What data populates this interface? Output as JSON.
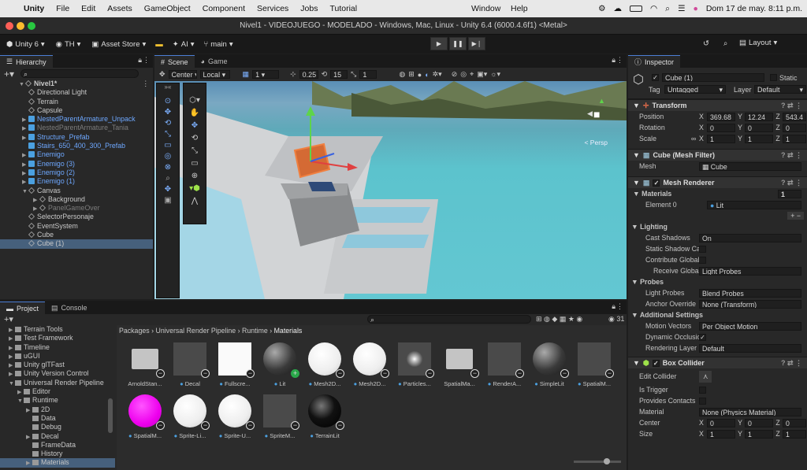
{
  "mac_menu": {
    "app": "Unity",
    "items": [
      "File",
      "Edit",
      "Assets",
      "GameObject",
      "Component",
      "Services",
      "Jobs",
      "Tutorial"
    ],
    "window": "Window",
    "help": "Help",
    "datetime": "Dom 17 de may. 8:11 p.m."
  },
  "title": "Nivel1 - VIDEOJUEGO - MODELADO - Windows, Mac, Linux - Unity 6.4 (6000.4.6f1) <Metal>",
  "toolbar": {
    "unity": "Unity 6",
    "account": "TH",
    "asset_store": "Asset Store",
    "ai": "AI",
    "branch": "main",
    "layout": "Layout"
  },
  "hierarchy": {
    "tab": "Hierarchy",
    "scene": "Nivel1*",
    "items": [
      {
        "label": "Directional Light",
        "indent": 2,
        "type": "obj",
        "arrow": ""
      },
      {
        "label": "Terrain",
        "indent": 2,
        "type": "obj",
        "arrow": ""
      },
      {
        "label": "Capsule",
        "indent": 2,
        "type": "obj",
        "arrow": ""
      },
      {
        "label": "NestedParentArmature_Unpack",
        "indent": 2,
        "type": "prefab",
        "arrow": "▶",
        "hl": true
      },
      {
        "label": "NestedParentArmature_Tania",
        "indent": 2,
        "type": "prefab",
        "arrow": "▶",
        "dim": true
      },
      {
        "label": "Structure_Prefab",
        "indent": 2,
        "type": "prefab",
        "arrow": "▶",
        "hl": true
      },
      {
        "label": "Stairs_650_400_300_Prefab",
        "indent": 2,
        "type": "prefab",
        "arrow": "",
        "hl": true
      },
      {
        "label": "Enemigo",
        "indent": 2,
        "type": "prefab",
        "arrow": "▶",
        "hl": true
      },
      {
        "label": "Enemigo (3)",
        "indent": 2,
        "type": "prefab",
        "arrow": "▶",
        "hl": true
      },
      {
        "label": "Enemigo (2)",
        "indent": 2,
        "type": "prefab",
        "arrow": "▶",
        "hl": true
      },
      {
        "label": "Enemigo (1)",
        "indent": 2,
        "type": "prefab",
        "arrow": "▶",
        "hl": true
      },
      {
        "label": "Canvas",
        "indent": 2,
        "type": "obj",
        "arrow": "▼"
      },
      {
        "label": "Background",
        "indent": 3,
        "type": "obj",
        "arrow": "▶"
      },
      {
        "label": "PanelGameOver",
        "indent": 3,
        "type": "obj",
        "arrow": "▶",
        "dim": true
      },
      {
        "label": "SelectorPersonaje",
        "indent": 2,
        "type": "obj",
        "arrow": ""
      },
      {
        "label": "EventSystem",
        "indent": 2,
        "type": "obj",
        "arrow": ""
      },
      {
        "label": "Cube",
        "indent": 2,
        "type": "obj",
        "arrow": ""
      },
      {
        "label": "Cube (1)",
        "indent": 2,
        "type": "obj",
        "arrow": "",
        "sel": true
      }
    ]
  },
  "scene": {
    "tab_scene": "Scene",
    "tab_game": "Game",
    "pivot": "Center",
    "space": "Local",
    "grid": "1",
    "snap1": "0.25",
    "snap2": "15",
    "snap3": "1",
    "persp": "< Persp"
  },
  "project": {
    "tab": "Project",
    "console": "Console",
    "count": "31",
    "breadcrumb": [
      "Packages",
      "Universal Render Pipeline",
      "Runtime",
      "Materials"
    ],
    "tree": [
      {
        "label": "Terrain Tools",
        "indent": 1,
        "arrow": "▶"
      },
      {
        "label": "Test Framework",
        "indent": 1,
        "arrow": "▶"
      },
      {
        "label": "Timeline",
        "indent": 1,
        "arrow": "▶"
      },
      {
        "label": "uGUI",
        "indent": 1,
        "arrow": "▶"
      },
      {
        "label": "Unity glTFast",
        "indent": 1,
        "arrow": "▶"
      },
      {
        "label": "Unity Version Control",
        "indent": 1,
        "arrow": "▶"
      },
      {
        "label": "Universal Render Pipeline",
        "indent": 1,
        "arrow": "▼"
      },
      {
        "label": "Editor",
        "indent": 2,
        "arrow": "▶"
      },
      {
        "label": "Runtime",
        "indent": 2,
        "arrow": "▼"
      },
      {
        "label": "2D",
        "indent": 3,
        "arrow": "▶"
      },
      {
        "label": "Data",
        "indent": 3,
        "arrow": ""
      },
      {
        "label": "Debug",
        "indent": 3,
        "arrow": ""
      },
      {
        "label": "Decal",
        "indent": 3,
        "arrow": "▶"
      },
      {
        "label": "FrameData",
        "indent": 3,
        "arrow": ""
      },
      {
        "label": "History",
        "indent": 3,
        "arrow": ""
      },
      {
        "label": "Materials",
        "indent": 3,
        "arrow": "▶",
        "sel": true
      }
    ],
    "assets": [
      {
        "label": "ArnoldStan...",
        "kind": "folder",
        "noicon": true
      },
      {
        "label": "Decal",
        "kind": "dark"
      },
      {
        "label": "Fullscre...",
        "kind": "white"
      },
      {
        "label": "Lit",
        "kind": "sphere",
        "plus": true
      },
      {
        "label": "Mesh2D...",
        "kind": "wsphere"
      },
      {
        "label": "Mesh2D...",
        "kind": "wsphere"
      },
      {
        "label": "Particles...",
        "kind": "particle"
      },
      {
        "label": "SpatialMa...",
        "kind": "folder",
        "noicon": true
      },
      {
        "label": "RenderA...",
        "kind": "dark"
      },
      {
        "label": "SimpleLit",
        "kind": "sphere"
      },
      {
        "label": "SpatialM...",
        "kind": "dark"
      },
      {
        "label": "SpatialM...",
        "kind": "magenta"
      },
      {
        "label": "Sprite-Li...",
        "kind": "wsphere"
      },
      {
        "label": "Sprite-U...",
        "kind": "wsphere"
      },
      {
        "label": "SpriteM...",
        "kind": "dark"
      },
      {
        "label": "TerrainLit",
        "kind": "bsphere"
      }
    ]
  },
  "inspector": {
    "tab": "Inspector",
    "name": "Cube (1)",
    "static": "Static",
    "tag_label": "Tag",
    "tag": "Untagged",
    "layer_label": "Layer",
    "layer": "Default",
    "transform": {
      "title": "Transform",
      "position": "Position",
      "rotation": "Rotation",
      "scale": "Scale",
      "pos": [
        "369.68",
        "12.24",
        "543.4"
      ],
      "rot": [
        "0",
        "0",
        "0"
      ],
      "scl": [
        "1",
        "1",
        "1"
      ]
    },
    "mesh_filter": {
      "title": "Cube (Mesh Filter)",
      "mesh_label": "Mesh",
      "mesh": "Cube"
    },
    "mesh_renderer": {
      "title": "Mesh Renderer",
      "materials": "Materials",
      "count": "1",
      "element": "Element 0",
      "element_val": "Lit",
      "lighting": "Lighting",
      "cast_shadows": "Cast Shadows",
      "cast_val": "On",
      "static_shadow": "Static Shadow Cas",
      "contribute_gi": "Contribute Global I",
      "receive_gi": "Receive Global I",
      "receive_val": "Light Probes",
      "probes": "Probes",
      "light_probes": "Light Probes",
      "light_val": "Blend Probes",
      "anchor": "Anchor Override",
      "anchor_val": "None (Transform)",
      "additional": "Additional Settings",
      "motion": "Motion Vectors",
      "motion_val": "Per Object Motion",
      "dynamic": "Dynamic Occlusion",
      "layer_mask": "Rendering Layer M",
      "layer_mask_val": "Default"
    },
    "box_collider": {
      "title": "Box Collider",
      "edit": "Edit Collider",
      "trigger": "Is Trigger",
      "contacts": "Provides Contacts",
      "material": "Material",
      "material_val": "None (Physics Material)",
      "center": "Center",
      "size": "Size",
      "c": [
        "0",
        "0",
        "0"
      ],
      "s": [
        "1",
        "1",
        "1"
      ]
    }
  }
}
